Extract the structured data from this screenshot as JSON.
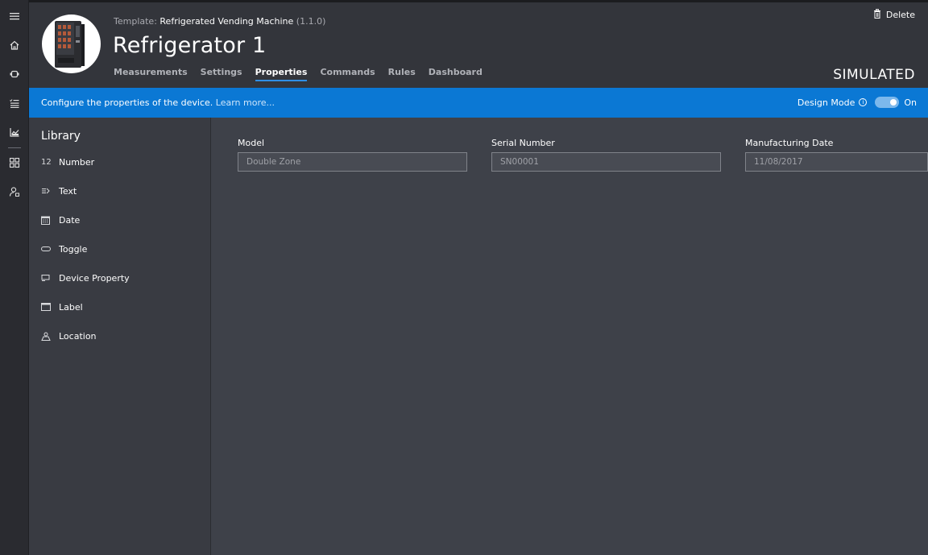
{
  "header": {
    "template_prefix": "Template:",
    "template_name": "Refrigerated Vending Machine",
    "template_version": "(1.1.0)",
    "device_title": "Refrigerator 1",
    "delete_label": "Delete",
    "status_label": "SIMULATED",
    "tabs": [
      {
        "label": "Measurements",
        "active": false
      },
      {
        "label": "Settings",
        "active": false
      },
      {
        "label": "Properties",
        "active": true
      },
      {
        "label": "Commands",
        "active": false
      },
      {
        "label": "Rules",
        "active": false
      },
      {
        "label": "Dashboard",
        "active": false
      }
    ]
  },
  "bluebar": {
    "message": "Configure the properties of the device.",
    "learn_more": "Learn more...",
    "design_mode_label": "Design Mode",
    "design_mode_state": "On",
    "accent_color": "#0b78d4"
  },
  "library": {
    "title": "Library",
    "items": [
      {
        "label": "Number",
        "icon": "number-icon",
        "glyph": "12"
      },
      {
        "label": "Text",
        "icon": "text-icon"
      },
      {
        "label": "Date",
        "icon": "calendar-icon"
      },
      {
        "label": "Toggle",
        "icon": "toggle-icon"
      },
      {
        "label": "Device Property",
        "icon": "device-property-icon"
      },
      {
        "label": "Label",
        "icon": "label-icon"
      },
      {
        "label": "Location",
        "icon": "location-icon"
      }
    ]
  },
  "properties": [
    {
      "label": "Model",
      "value": "Double Zone"
    },
    {
      "label": "Serial Number",
      "value": "SN00001"
    },
    {
      "label": "Manufacturing Date",
      "value": "11/08/2017"
    }
  ],
  "rail": {
    "icons": [
      "hamburger-menu-icon",
      "home-icon",
      "devices-icon",
      "rules-list-icon",
      "analytics-icon",
      "dashboard-grid-icon",
      "user-admin-icon"
    ]
  }
}
